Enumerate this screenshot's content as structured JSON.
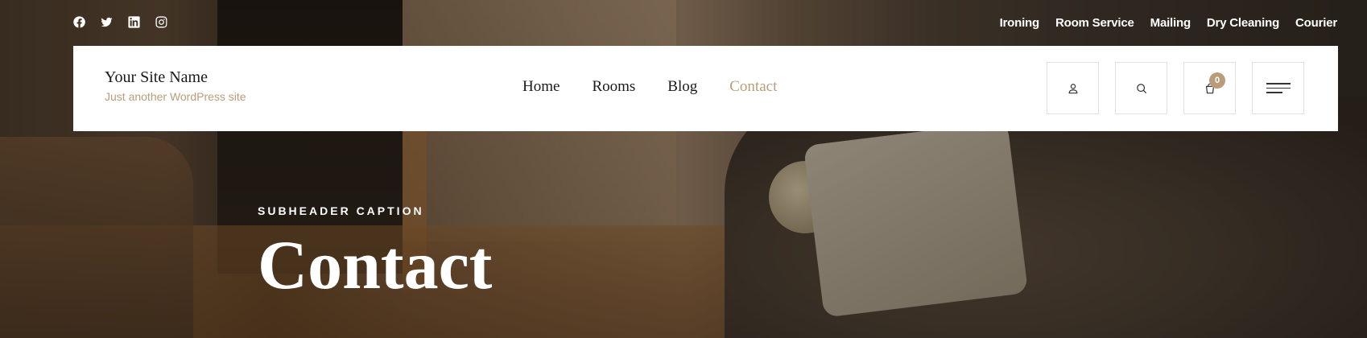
{
  "social": [
    {
      "name": "facebook-icon"
    },
    {
      "name": "twitter-icon"
    },
    {
      "name": "linkedin-icon"
    },
    {
      "name": "instagram-icon"
    }
  ],
  "top_links": [
    "Ironing",
    "Room Service",
    "Mailing",
    "Dry Cleaning",
    "Courier"
  ],
  "brand": {
    "name": "Your Site Name",
    "tagline": "Just another WordPress site"
  },
  "nav": {
    "items": [
      "Home",
      "Rooms",
      "Blog",
      "Contact"
    ],
    "active": "Contact"
  },
  "actions": {
    "cart_count": "0",
    "icons": [
      "user-icon",
      "search-icon",
      "cart-icon",
      "menu-icon"
    ]
  },
  "hero": {
    "caption": "SUBHEADER CAPTION",
    "title": "Contact"
  },
  "colors": {
    "accent": "#b99d7a",
    "header_bg": "#ffffff",
    "text": "#1a1a1a"
  }
}
